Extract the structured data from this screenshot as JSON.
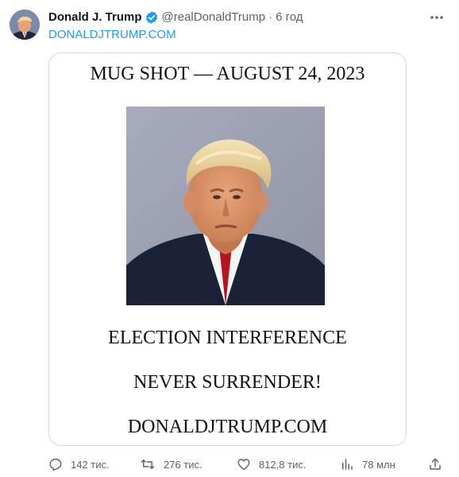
{
  "author": {
    "display_name": "Donald J. Trump",
    "handle": "@realDonaldTrump",
    "separator": "·",
    "time": "6 год",
    "verified_color": "#1d9bf0"
  },
  "tweet": {
    "link_text": "DONALDJTRUMP.COM",
    "link_color": "#1d9bf0"
  },
  "media": {
    "title": "MUG SHOT — AUGUST 24, 2023",
    "line1": "ELECTION INTERFERENCE",
    "line2": "NEVER SURRENDER!",
    "line3": "DONALDJTRUMP.COM"
  },
  "actions": {
    "replies": "142 тис.",
    "retweets": "276 тис.",
    "likes": "812,8 тис.",
    "views": "78 млн"
  },
  "icons": {
    "avatar": "avatar-photo",
    "verified": "verified-badge-icon",
    "more": "more-icon",
    "reply": "reply-icon",
    "retweet": "retweet-icon",
    "like": "heart-icon",
    "views": "views-chart-icon",
    "share": "share-icon"
  }
}
